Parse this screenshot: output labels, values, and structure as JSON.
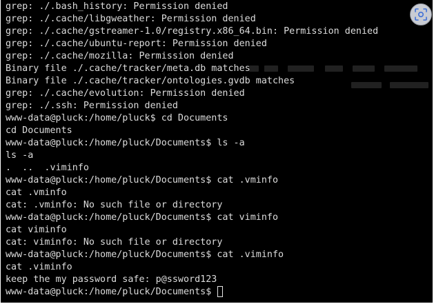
{
  "terminal": {
    "lines": [
      "grep: ./.bash_history: Permission denied",
      "grep: ./.cache/libgweather: Permission denied",
      "grep: ./.cache/gstreamer-1.0/registry.x86_64.bin: Permission denied",
      "grep: ./.cache/ubuntu-report: Permission denied",
      "grep: ./.cache/mozilla: Permission denied",
      "Binary file ./.cache/tracker/meta.db matches",
      "Binary file ./.cache/tracker/ontologies.gvdb matches",
      "grep: ./.cache/evolution: Permission denied",
      "grep: ./.ssh: Permission denied",
      "www-data@pluck:/home/pluck$ cd Documents",
      "cd Documents",
      "www-data@pluck:/home/pluck/Documents$ ls -a",
      "ls -a",
      ".  ..  .viminfo",
      "www-data@pluck:/home/pluck/Documents$ cat .vminfo",
      "cat .vminfo",
      "cat: .vminfo: No such file or directory",
      "www-data@pluck:/home/pluck/Documents$ cat viminfo",
      "cat viminfo",
      "cat: viminfo: No such file or directory",
      "www-data@pluck:/home/pluck/Documents$ cat .viminfo",
      "cat .viminfo",
      "keep the my password safe: p@ssword123"
    ],
    "prompt": "www-data@pluck:/home/pluck/Documents$ "
  },
  "overlay": {
    "icon": "screen-capture-icon"
  },
  "colors": {
    "background": "#000000",
    "text": "#dcdcdc"
  }
}
